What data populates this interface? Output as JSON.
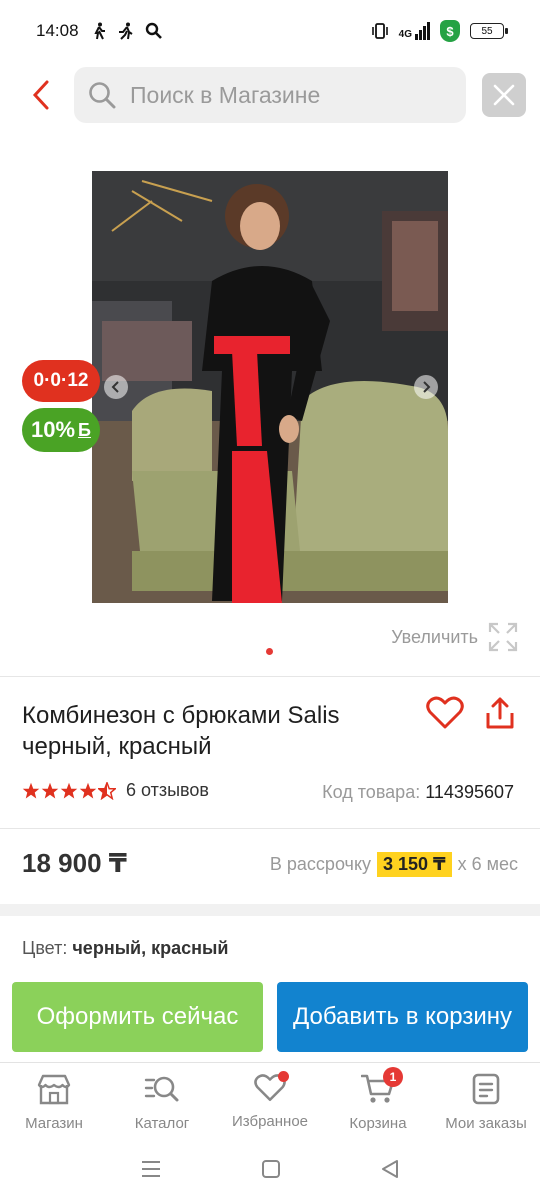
{
  "status_bar": {
    "time": "14:08",
    "network": "4G",
    "battery": "55"
  },
  "search": {
    "placeholder": "Поиск в Магазине"
  },
  "gallery": {
    "timer_badge": "0·0·12",
    "bonus_badge": "10%",
    "bonus_currency": "Б",
    "zoom_label": "Увеличить"
  },
  "product": {
    "title": "Комбинезон с брюками Salis черный, красный",
    "rating": 4.5,
    "reviews": "6 отзывов",
    "sku_label": "Код товара:",
    "sku_value": "114395607",
    "price": "18 900 ₸",
    "installment_label": "В рассрочку",
    "installment_amount": "3 150 ₸",
    "installment_term": "х 6 мес",
    "color_label": "Цвет:",
    "color_value": "черный, красный"
  },
  "actions": {
    "buy_now": "Оформить сейчас",
    "add_to_cart": "Добавить в корзину"
  },
  "bottom_nav": [
    {
      "label": "Магазин",
      "icon": "shop-icon"
    },
    {
      "label": "Каталог",
      "icon": "catalog-search-icon"
    },
    {
      "label": "Избранное",
      "icon": "heart-icon"
    },
    {
      "label": "Корзина",
      "icon": "cart-icon",
      "badge": "1"
    },
    {
      "label": "Мои заказы",
      "icon": "orders-icon"
    }
  ],
  "colors": {
    "accent_red": "#e0311f",
    "bonus_green": "#4aa325",
    "buy_green": "#8bd15a",
    "cart_blue": "#1283cf",
    "installment_yellow": "#ffd21f"
  }
}
